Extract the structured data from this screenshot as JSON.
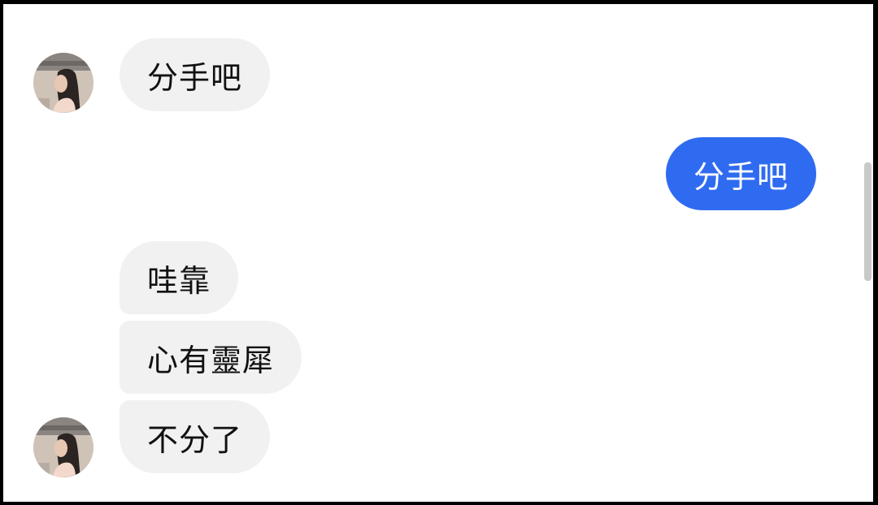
{
  "messages": [
    {
      "sender": "other",
      "text": "分手吧"
    },
    {
      "sender": "me",
      "text": "分手吧"
    },
    {
      "sender": "other",
      "text": "哇靠"
    },
    {
      "sender": "other",
      "text": "心有靈犀"
    },
    {
      "sender": "other",
      "text": "不分了"
    }
  ],
  "colors": {
    "incoming_bubble": "#f1f1f2",
    "outgoing_bubble": "#2f6bf0",
    "background": "#ffffff",
    "frame": "#000000"
  },
  "icons": {
    "avatar": "user-avatar-photo"
  }
}
